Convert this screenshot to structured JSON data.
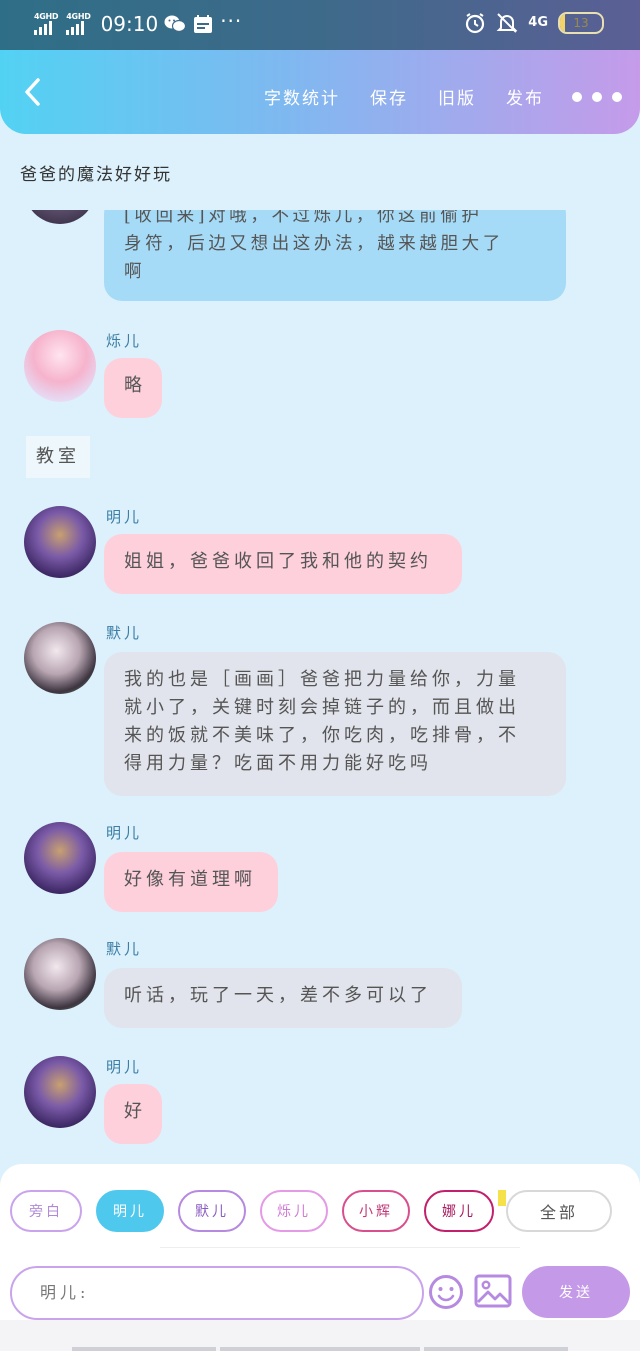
{
  "status_bar": {
    "signal1": "4GHD",
    "signal2": "4GHD",
    "time": "09:10",
    "dots": "···",
    "network": "4G",
    "battery": "13"
  },
  "toolbar": {
    "word_count": "字数统计",
    "save": "保存",
    "old_version": "旧版",
    "publish": "发布"
  },
  "story": {
    "title": "爸爸的魔法好好玩"
  },
  "messages": [
    {
      "speaker": "",
      "lines": [
        "[收回来]对哦，不过烁儿，你这前偷护",
        "身符，后边又想出这办法，越来越胆大了",
        "啊"
      ]
    },
    {
      "speaker": "烁儿",
      "text": "略"
    },
    {
      "speaker": "明儿",
      "text": "姐姐，爸爸收回了我和他的契约"
    },
    {
      "speaker": "默儿",
      "lines": [
        "我的也是［画画］爸爸把力量给你，力量",
        "就小了，关键时刻会掉链子的，而且做出",
        "来的饭就不美味了，你吃肉，吃排骨，不",
        "得用力量？吃面不用力能好吃吗"
      ]
    },
    {
      "speaker": "明儿",
      "text": "好像有道理啊"
    },
    {
      "speaker": "默儿",
      "text": "听话，玩了一天，差不多可以了"
    },
    {
      "speaker": "明儿",
      "text": "好"
    }
  ],
  "scene_label": "教室",
  "roles": [
    "旁白",
    "明儿",
    "默儿",
    "烁儿",
    "小辉",
    "娜儿",
    "全部"
  ],
  "input": {
    "value": "明儿:"
  },
  "send_label": "发送",
  "colors": {
    "accent_blue": "#52d2f3",
    "accent_purple": "#c49ae8",
    "bubble_pink": "#fdd0dc",
    "bubble_blue": "#a6dbf7",
    "bubble_grey": "#e1e4ec"
  }
}
